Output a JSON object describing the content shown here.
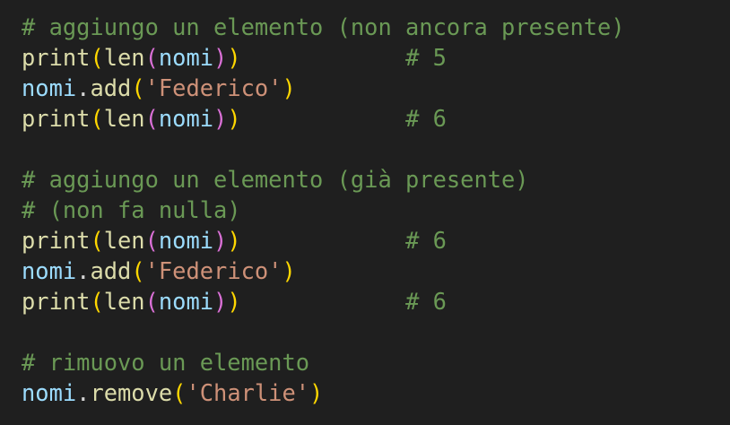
{
  "editor": {
    "colors": {
      "background": "#1f1f1f",
      "comment": "#6a9955",
      "function": "#dcdcaa",
      "variable": "#9cdcfe",
      "string": "#ce9178",
      "plain": "#d4d4d4",
      "bracket_level_1": "#ffd700",
      "bracket_level_2": "#da70d6"
    },
    "lines": [
      [
        {
          "t": "# aggiungo un elemento (non ancora presente)",
          "c": "comment"
        }
      ],
      [
        {
          "t": "print",
          "c": "func"
        },
        {
          "t": "(",
          "c": "p1"
        },
        {
          "t": "len",
          "c": "func"
        },
        {
          "t": "(",
          "c": "p2"
        },
        {
          "t": "nomi",
          "c": "var"
        },
        {
          "t": ")",
          "c": "p2"
        },
        {
          "t": ")",
          "c": "p1"
        },
        {
          "t": "            ",
          "c": "plain"
        },
        {
          "t": "# 5",
          "c": "comment"
        }
      ],
      [
        {
          "t": "nomi",
          "c": "var"
        },
        {
          "t": ".",
          "c": "plain"
        },
        {
          "t": "add",
          "c": "func"
        },
        {
          "t": "(",
          "c": "p1"
        },
        {
          "t": "'Federico'",
          "c": "str"
        },
        {
          "t": ")",
          "c": "p1"
        }
      ],
      [
        {
          "t": "print",
          "c": "func"
        },
        {
          "t": "(",
          "c": "p1"
        },
        {
          "t": "len",
          "c": "func"
        },
        {
          "t": "(",
          "c": "p2"
        },
        {
          "t": "nomi",
          "c": "var"
        },
        {
          "t": ")",
          "c": "p2"
        },
        {
          "t": ")",
          "c": "p1"
        },
        {
          "t": "            ",
          "c": "plain"
        },
        {
          "t": "# 6",
          "c": "comment"
        }
      ],
      [],
      [
        {
          "t": "# aggiungo un elemento (già presente)",
          "c": "comment"
        }
      ],
      [
        {
          "t": "# (non fa nulla)",
          "c": "comment"
        }
      ],
      [
        {
          "t": "print",
          "c": "func"
        },
        {
          "t": "(",
          "c": "p1"
        },
        {
          "t": "len",
          "c": "func"
        },
        {
          "t": "(",
          "c": "p2"
        },
        {
          "t": "nomi",
          "c": "var"
        },
        {
          "t": ")",
          "c": "p2"
        },
        {
          "t": ")",
          "c": "p1"
        },
        {
          "t": "            ",
          "c": "plain"
        },
        {
          "t": "# 6",
          "c": "comment"
        }
      ],
      [
        {
          "t": "nomi",
          "c": "var"
        },
        {
          "t": ".",
          "c": "plain"
        },
        {
          "t": "add",
          "c": "func"
        },
        {
          "t": "(",
          "c": "p1"
        },
        {
          "t": "'Federico'",
          "c": "str"
        },
        {
          "t": ")",
          "c": "p1"
        }
      ],
      [
        {
          "t": "print",
          "c": "func"
        },
        {
          "t": "(",
          "c": "p1"
        },
        {
          "t": "len",
          "c": "func"
        },
        {
          "t": "(",
          "c": "p2"
        },
        {
          "t": "nomi",
          "c": "var"
        },
        {
          "t": ")",
          "c": "p2"
        },
        {
          "t": ")",
          "c": "p1"
        },
        {
          "t": "            ",
          "c": "plain"
        },
        {
          "t": "# 6",
          "c": "comment"
        }
      ],
      [],
      [
        {
          "t": "# rimuovo un elemento",
          "c": "comment"
        }
      ],
      [
        {
          "t": "nomi",
          "c": "var"
        },
        {
          "t": ".",
          "c": "plain"
        },
        {
          "t": "remove",
          "c": "func"
        },
        {
          "t": "(",
          "c": "p1"
        },
        {
          "t": "'Charlie'",
          "c": "str"
        },
        {
          "t": ")",
          "c": "p1"
        }
      ]
    ]
  }
}
